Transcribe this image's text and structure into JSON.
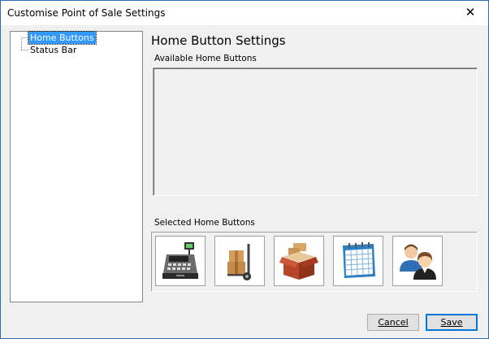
{
  "window": {
    "title": "Customise Point of Sale Settings",
    "close_glyph": "✕"
  },
  "tree": {
    "items": [
      {
        "label": "Home Buttons",
        "selected": true
      },
      {
        "label": "Status Bar",
        "selected": false
      }
    ]
  },
  "main": {
    "heading": "Home Button Settings",
    "available_label": "Available Home Buttons",
    "selected_label": "Selected Home Buttons",
    "selected_buttons": [
      {
        "icon": "cash-register-icon"
      },
      {
        "icon": "hand-truck-boxes-icon"
      },
      {
        "icon": "open-box-icon"
      },
      {
        "icon": "calendar-icon"
      },
      {
        "icon": "customers-icon"
      }
    ]
  },
  "buttons": {
    "cancel_label": "Cancel",
    "save_label": "Save"
  },
  "colors": {
    "selection": "#3399ff",
    "default_button_border": "#0078d7"
  }
}
